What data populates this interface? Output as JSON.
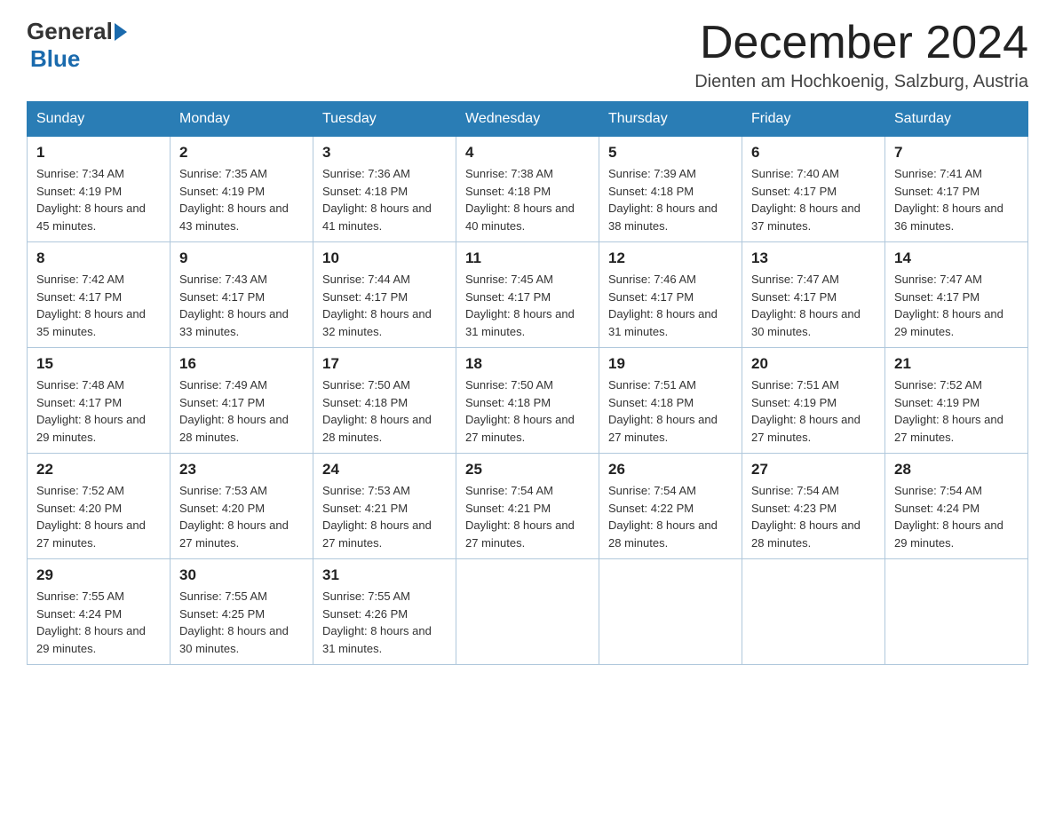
{
  "header": {
    "logo_general": "General",
    "logo_blue": "Blue",
    "month_title": "December 2024",
    "location": "Dienten am Hochkoenig, Salzburg, Austria"
  },
  "weekdays": [
    "Sunday",
    "Monday",
    "Tuesday",
    "Wednesday",
    "Thursday",
    "Friday",
    "Saturday"
  ],
  "weeks": [
    [
      {
        "day": "1",
        "sunrise": "7:34 AM",
        "sunset": "4:19 PM",
        "daylight": "8 hours and 45 minutes."
      },
      {
        "day": "2",
        "sunrise": "7:35 AM",
        "sunset": "4:19 PM",
        "daylight": "8 hours and 43 minutes."
      },
      {
        "day": "3",
        "sunrise": "7:36 AM",
        "sunset": "4:18 PM",
        "daylight": "8 hours and 41 minutes."
      },
      {
        "day": "4",
        "sunrise": "7:38 AM",
        "sunset": "4:18 PM",
        "daylight": "8 hours and 40 minutes."
      },
      {
        "day": "5",
        "sunrise": "7:39 AM",
        "sunset": "4:18 PM",
        "daylight": "8 hours and 38 minutes."
      },
      {
        "day": "6",
        "sunrise": "7:40 AM",
        "sunset": "4:17 PM",
        "daylight": "8 hours and 37 minutes."
      },
      {
        "day": "7",
        "sunrise": "7:41 AM",
        "sunset": "4:17 PM",
        "daylight": "8 hours and 36 minutes."
      }
    ],
    [
      {
        "day": "8",
        "sunrise": "7:42 AM",
        "sunset": "4:17 PM",
        "daylight": "8 hours and 35 minutes."
      },
      {
        "day": "9",
        "sunrise": "7:43 AM",
        "sunset": "4:17 PM",
        "daylight": "8 hours and 33 minutes."
      },
      {
        "day": "10",
        "sunrise": "7:44 AM",
        "sunset": "4:17 PM",
        "daylight": "8 hours and 32 minutes."
      },
      {
        "day": "11",
        "sunrise": "7:45 AM",
        "sunset": "4:17 PM",
        "daylight": "8 hours and 31 minutes."
      },
      {
        "day": "12",
        "sunrise": "7:46 AM",
        "sunset": "4:17 PM",
        "daylight": "8 hours and 31 minutes."
      },
      {
        "day": "13",
        "sunrise": "7:47 AM",
        "sunset": "4:17 PM",
        "daylight": "8 hours and 30 minutes."
      },
      {
        "day": "14",
        "sunrise": "7:47 AM",
        "sunset": "4:17 PM",
        "daylight": "8 hours and 29 minutes."
      }
    ],
    [
      {
        "day": "15",
        "sunrise": "7:48 AM",
        "sunset": "4:17 PM",
        "daylight": "8 hours and 29 minutes."
      },
      {
        "day": "16",
        "sunrise": "7:49 AM",
        "sunset": "4:17 PM",
        "daylight": "8 hours and 28 minutes."
      },
      {
        "day": "17",
        "sunrise": "7:50 AM",
        "sunset": "4:18 PM",
        "daylight": "8 hours and 28 minutes."
      },
      {
        "day": "18",
        "sunrise": "7:50 AM",
        "sunset": "4:18 PM",
        "daylight": "8 hours and 27 minutes."
      },
      {
        "day": "19",
        "sunrise": "7:51 AM",
        "sunset": "4:18 PM",
        "daylight": "8 hours and 27 minutes."
      },
      {
        "day": "20",
        "sunrise": "7:51 AM",
        "sunset": "4:19 PM",
        "daylight": "8 hours and 27 minutes."
      },
      {
        "day": "21",
        "sunrise": "7:52 AM",
        "sunset": "4:19 PM",
        "daylight": "8 hours and 27 minutes."
      }
    ],
    [
      {
        "day": "22",
        "sunrise": "7:52 AM",
        "sunset": "4:20 PM",
        "daylight": "8 hours and 27 minutes."
      },
      {
        "day": "23",
        "sunrise": "7:53 AM",
        "sunset": "4:20 PM",
        "daylight": "8 hours and 27 minutes."
      },
      {
        "day": "24",
        "sunrise": "7:53 AM",
        "sunset": "4:21 PM",
        "daylight": "8 hours and 27 minutes."
      },
      {
        "day": "25",
        "sunrise": "7:54 AM",
        "sunset": "4:21 PM",
        "daylight": "8 hours and 27 minutes."
      },
      {
        "day": "26",
        "sunrise": "7:54 AM",
        "sunset": "4:22 PM",
        "daylight": "8 hours and 28 minutes."
      },
      {
        "day": "27",
        "sunrise": "7:54 AM",
        "sunset": "4:23 PM",
        "daylight": "8 hours and 28 minutes."
      },
      {
        "day": "28",
        "sunrise": "7:54 AM",
        "sunset": "4:24 PM",
        "daylight": "8 hours and 29 minutes."
      }
    ],
    [
      {
        "day": "29",
        "sunrise": "7:55 AM",
        "sunset": "4:24 PM",
        "daylight": "8 hours and 29 minutes."
      },
      {
        "day": "30",
        "sunrise": "7:55 AM",
        "sunset": "4:25 PM",
        "daylight": "8 hours and 30 minutes."
      },
      {
        "day": "31",
        "sunrise": "7:55 AM",
        "sunset": "4:26 PM",
        "daylight": "8 hours and 31 minutes."
      },
      null,
      null,
      null,
      null
    ]
  ]
}
